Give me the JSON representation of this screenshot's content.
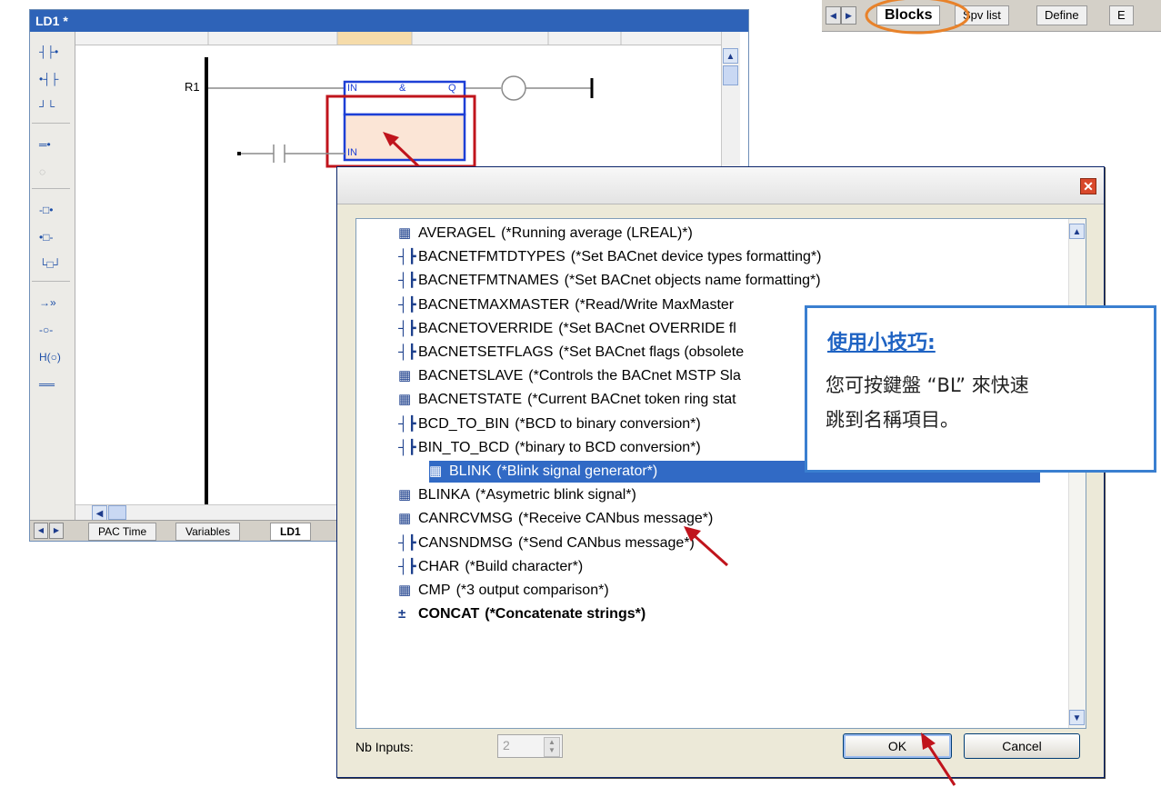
{
  "top_tabs": {
    "items": [
      "Blocks",
      "Spv list",
      "Define",
      "E"
    ],
    "active": "Blocks"
  },
  "ld_window": {
    "title": "LD1 *",
    "rung_label": "R1",
    "block_top": {
      "in": "IN",
      "op": "&",
      "out": "Q"
    },
    "block_new": {
      "in": "IN"
    },
    "toolbar_icons": [
      "contact-left-icon",
      "contact-right-icon",
      "parallel-contact-icon",
      "horizontal-link-icon",
      "coil-icon",
      "block-left-icon",
      "block-right-icon",
      "parallel-block-icon",
      "jump-icon",
      "return-coil-icon",
      "negated-coil-icon",
      "line-icon"
    ],
    "bottom_tabs": [
      "PAC Time",
      "Variables",
      "LD1"
    ],
    "active_tab": "LD1"
  },
  "dialog": {
    "items": [
      {
        "name": "AVERAGEL",
        "desc": "(*Running average (LREAL)*)",
        "icon": "fb"
      },
      {
        "name": "BACNETFMTDTYPES",
        "desc": "(*Set BACnet device types formatting*)",
        "icon": "fn"
      },
      {
        "name": "BACNETFMTNAMES",
        "desc": "(*Set BACnet objects name formatting*)",
        "icon": "fn"
      },
      {
        "name": "BACNETMAXMASTER",
        "desc": "(*Read/Write MaxMaster",
        "icon": "fn"
      },
      {
        "name": "BACNETOVERRIDE",
        "desc": "(*Set BACnet OVERRIDE fl",
        "icon": "fn"
      },
      {
        "name": "BACNETSETFLAGS",
        "desc": "(*Set BACnet flags (obsolete",
        "icon": "fn"
      },
      {
        "name": "BACNETSLAVE",
        "desc": "(*Controls the BACnet MSTP Sla",
        "icon": "fb"
      },
      {
        "name": "BACNETSTATE",
        "desc": "(*Current BACnet token ring stat",
        "icon": "fb"
      },
      {
        "name": "BCD_TO_BIN",
        "desc": "(*BCD to binary conversion*)",
        "icon": "fn"
      },
      {
        "name": "BIN_TO_BCD",
        "desc": "(*binary to BCD conversion*)",
        "icon": "fn"
      },
      {
        "name": "BLINK",
        "desc": "(*Blink signal generator*)",
        "icon": "fb",
        "selected": true
      },
      {
        "name": "BLINKA",
        "desc": "(*Asymetric blink signal*)",
        "icon": "fb"
      },
      {
        "name": "CANRCVMSG",
        "desc": "(*Receive CANbus message*)",
        "icon": "fb"
      },
      {
        "name": "CANSNDMSG",
        "desc": "(*Send CANbus message*)",
        "icon": "fn"
      },
      {
        "name": "CHAR",
        "desc": "(*Build character*)",
        "icon": "fn"
      },
      {
        "name": "CMP",
        "desc": "(*3 output comparison*)",
        "icon": "fb"
      },
      {
        "name": "CONCAT",
        "desc": "(*Concatenate strings*)",
        "icon": "op",
        "bold": true
      }
    ],
    "nb_inputs_label": "Nb Inputs:",
    "nb_inputs_value": "2",
    "ok_label": "OK",
    "cancel_label": "Cancel"
  },
  "tip": {
    "title": "使用小技巧:",
    "line1": "您可按鍵盤 “BL” 來快速",
    "line2": "跳到名稱項目。"
  },
  "colors": {
    "annotation_red": "#c0141c",
    "highlight_orange": "#e8822a",
    "selection_blue": "#316ac5",
    "tip_border": "#3a7fd0"
  }
}
